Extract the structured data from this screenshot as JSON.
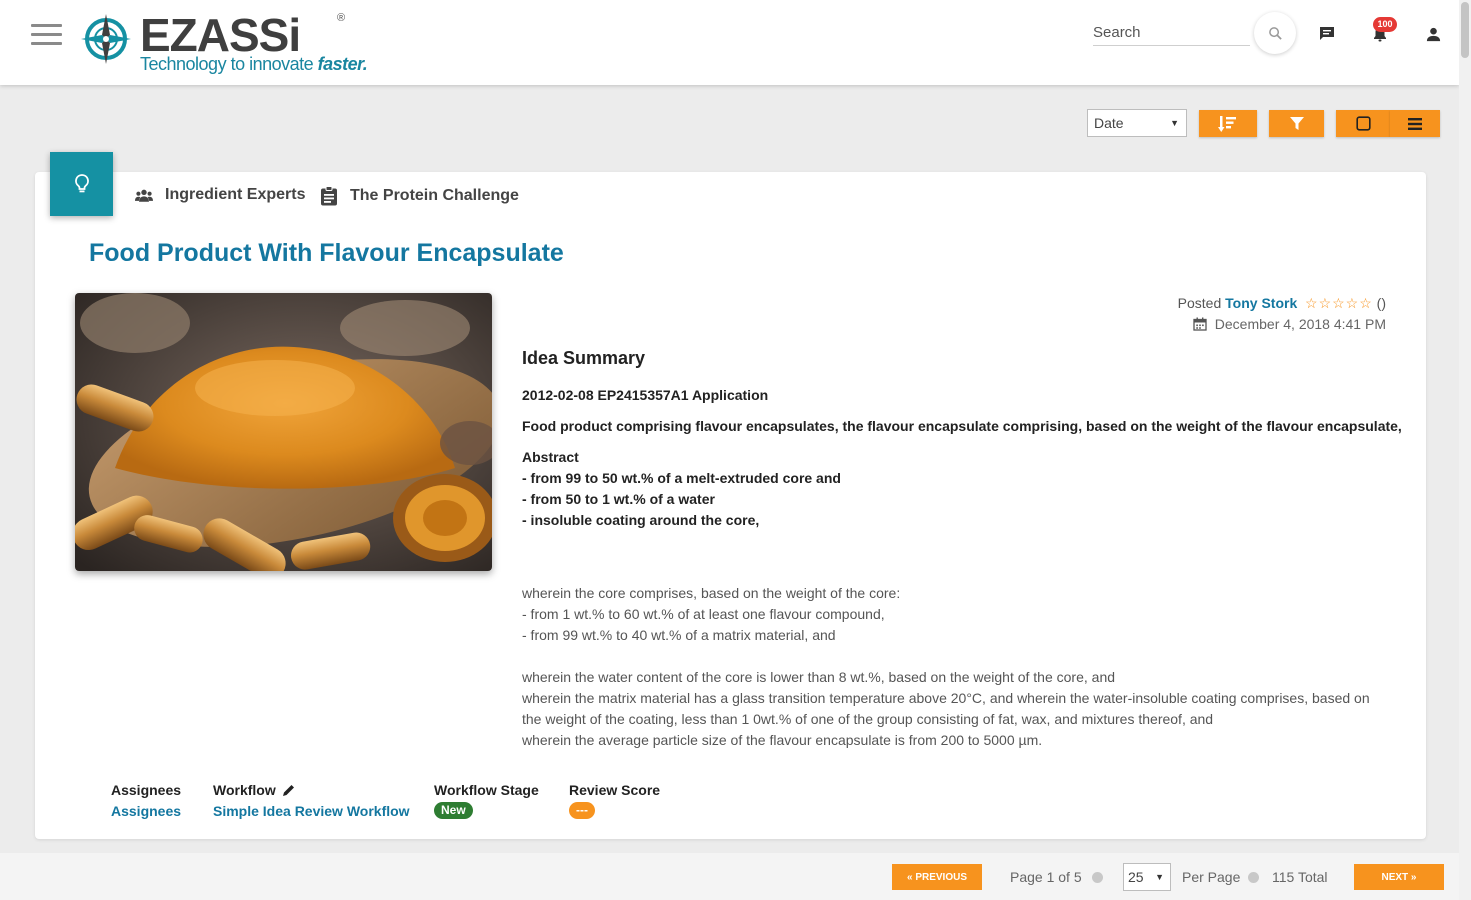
{
  "header": {
    "logo_text": "EZASSi",
    "logo_tagline": "Technology to innovate",
    "logo_tagline_em": "faster.",
    "logo_registered": "®",
    "search_placeholder": "Search",
    "notification_count": "100",
    "icons": [
      "menu-icon",
      "search-icon",
      "chat-icon",
      "bell-icon",
      "user-icon"
    ]
  },
  "toolbar": {
    "sort_select_value": "Date",
    "icons": [
      "sort-icon",
      "filter-icon",
      "card-view-icon",
      "list-view-icon"
    ]
  },
  "idea": {
    "group": "Ingredient Experts",
    "challenge": "The Protein Challenge",
    "title": "Food Product With Flavour Encapsulate",
    "posted_label": "Posted",
    "author": "Tony Stork",
    "rating_stars": "☆☆☆☆☆",
    "rating_count": "()",
    "date": "December 4, 2018 4:41 PM",
    "summary_heading": "Idea Summary",
    "summary_bold": [
      "2012-02-08 EP2415357A1 Application",
      "Food product comprising flavour encapsulates, the flavour encapsulate comprising, based on the weight of the flavour encapsulate,"
    ],
    "abstract_lines": [
      "Abstract",
      "- from 99 to 50 wt.% of a melt-extruded core and",
      "- from 50 to 1 wt.% of a water",
      "- insoluble coating around the core,"
    ],
    "core_lines": [
      "wherein the core comprises, based on the weight of the core:",
      "- from 1 wt.% to 60 wt.% of at least one flavour compound,",
      "- from 99 wt.% to 40 wt.% of a matrix material, and"
    ],
    "water_lines": [
      "wherein the water content of the core is lower than 8 wt.%, based on the weight of the core, and",
      "wherein the matrix material has a glass transition temperature above 20°C, and wherein the water-insoluble coating comprises, based on the weight of the coating, less than 1 0wt.% of one of the group consisting of fat, wax, and mixtures thereof, and",
      "wherein the average particle size of the flavour encapsulate is from 200 to 5000 µm."
    ],
    "meta": {
      "assignees_label": "Assignees",
      "assignees_value": "Assignees",
      "workflow_label": "Workflow",
      "workflow_value": "Simple Idea Review Workflow",
      "stage_label": "Workflow Stage",
      "stage_value": "New",
      "score_label": "Review Score",
      "score_value": "---"
    }
  },
  "pagination": {
    "previous": "« PREVIOUS",
    "page_text": "Page 1 of 5",
    "per_page_value": "25",
    "per_page_label": "Per Page",
    "total_text": "115 Total",
    "next": "NEXT »"
  },
  "colors": {
    "accent_orange": "#f7931e",
    "brand_teal": "#1591a3",
    "link_blue": "#1477a0",
    "stage_green": "#2e7d32",
    "badge_red": "#e53935"
  }
}
